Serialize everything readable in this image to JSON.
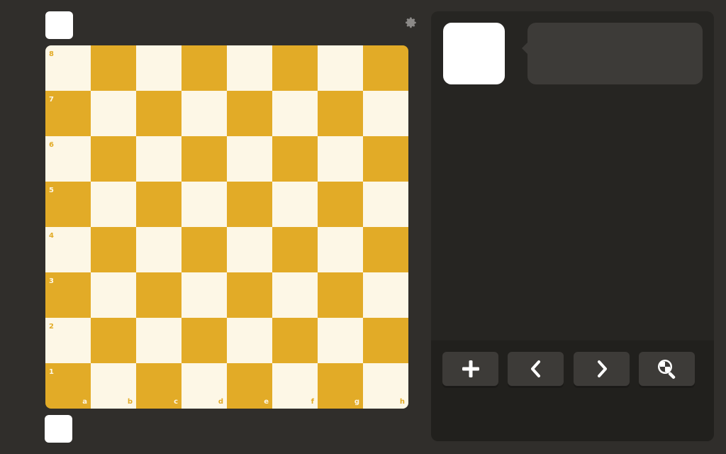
{
  "board": {
    "ranks": [
      "8",
      "7",
      "6",
      "5",
      "4",
      "3",
      "2",
      "1"
    ],
    "files": [
      "a",
      "b",
      "c",
      "d",
      "e",
      "f",
      "g",
      "h"
    ],
    "light_color": "#fdf7e6",
    "dark_color": "#e2ab27"
  },
  "icons": {
    "settings": "gear-icon",
    "new_game": "plus-icon",
    "previous": "chevron-left-icon",
    "next": "chevron-right-icon",
    "analysis": "magnifier-icon"
  },
  "colors": {
    "background": "#302e2b",
    "panel": "#262522",
    "button": "#3d3b38"
  }
}
